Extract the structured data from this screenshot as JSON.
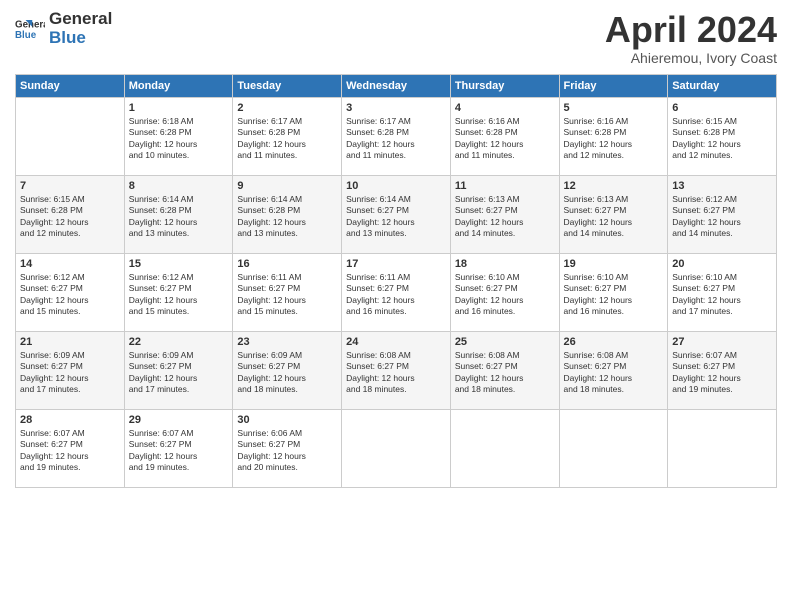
{
  "header": {
    "logo_line1": "General",
    "logo_line2": "Blue",
    "month": "April 2024",
    "location": "Ahieremou, Ivory Coast"
  },
  "weekdays": [
    "Sunday",
    "Monday",
    "Tuesday",
    "Wednesday",
    "Thursday",
    "Friday",
    "Saturday"
  ],
  "weeks": [
    [
      {
        "day": "",
        "info": ""
      },
      {
        "day": "1",
        "info": "Sunrise: 6:18 AM\nSunset: 6:28 PM\nDaylight: 12 hours\nand 10 minutes."
      },
      {
        "day": "2",
        "info": "Sunrise: 6:17 AM\nSunset: 6:28 PM\nDaylight: 12 hours\nand 11 minutes."
      },
      {
        "day": "3",
        "info": "Sunrise: 6:17 AM\nSunset: 6:28 PM\nDaylight: 12 hours\nand 11 minutes."
      },
      {
        "day": "4",
        "info": "Sunrise: 6:16 AM\nSunset: 6:28 PM\nDaylight: 12 hours\nand 11 minutes."
      },
      {
        "day": "5",
        "info": "Sunrise: 6:16 AM\nSunset: 6:28 PM\nDaylight: 12 hours\nand 12 minutes."
      },
      {
        "day": "6",
        "info": "Sunrise: 6:15 AM\nSunset: 6:28 PM\nDaylight: 12 hours\nand 12 minutes."
      }
    ],
    [
      {
        "day": "7",
        "info": "Sunrise: 6:15 AM\nSunset: 6:28 PM\nDaylight: 12 hours\nand 12 minutes."
      },
      {
        "day": "8",
        "info": "Sunrise: 6:14 AM\nSunset: 6:28 PM\nDaylight: 12 hours\nand 13 minutes."
      },
      {
        "day": "9",
        "info": "Sunrise: 6:14 AM\nSunset: 6:28 PM\nDaylight: 12 hours\nand 13 minutes."
      },
      {
        "day": "10",
        "info": "Sunrise: 6:14 AM\nSunset: 6:27 PM\nDaylight: 12 hours\nand 13 minutes."
      },
      {
        "day": "11",
        "info": "Sunrise: 6:13 AM\nSunset: 6:27 PM\nDaylight: 12 hours\nand 14 minutes."
      },
      {
        "day": "12",
        "info": "Sunrise: 6:13 AM\nSunset: 6:27 PM\nDaylight: 12 hours\nand 14 minutes."
      },
      {
        "day": "13",
        "info": "Sunrise: 6:12 AM\nSunset: 6:27 PM\nDaylight: 12 hours\nand 14 minutes."
      }
    ],
    [
      {
        "day": "14",
        "info": "Sunrise: 6:12 AM\nSunset: 6:27 PM\nDaylight: 12 hours\nand 15 minutes."
      },
      {
        "day": "15",
        "info": "Sunrise: 6:12 AM\nSunset: 6:27 PM\nDaylight: 12 hours\nand 15 minutes."
      },
      {
        "day": "16",
        "info": "Sunrise: 6:11 AM\nSunset: 6:27 PM\nDaylight: 12 hours\nand 15 minutes."
      },
      {
        "day": "17",
        "info": "Sunrise: 6:11 AM\nSunset: 6:27 PM\nDaylight: 12 hours\nand 16 minutes."
      },
      {
        "day": "18",
        "info": "Sunrise: 6:10 AM\nSunset: 6:27 PM\nDaylight: 12 hours\nand 16 minutes."
      },
      {
        "day": "19",
        "info": "Sunrise: 6:10 AM\nSunset: 6:27 PM\nDaylight: 12 hours\nand 16 minutes."
      },
      {
        "day": "20",
        "info": "Sunrise: 6:10 AM\nSunset: 6:27 PM\nDaylight: 12 hours\nand 17 minutes."
      }
    ],
    [
      {
        "day": "21",
        "info": "Sunrise: 6:09 AM\nSunset: 6:27 PM\nDaylight: 12 hours\nand 17 minutes."
      },
      {
        "day": "22",
        "info": "Sunrise: 6:09 AM\nSunset: 6:27 PM\nDaylight: 12 hours\nand 17 minutes."
      },
      {
        "day": "23",
        "info": "Sunrise: 6:09 AM\nSunset: 6:27 PM\nDaylight: 12 hours\nand 18 minutes."
      },
      {
        "day": "24",
        "info": "Sunrise: 6:08 AM\nSunset: 6:27 PM\nDaylight: 12 hours\nand 18 minutes."
      },
      {
        "day": "25",
        "info": "Sunrise: 6:08 AM\nSunset: 6:27 PM\nDaylight: 12 hours\nand 18 minutes."
      },
      {
        "day": "26",
        "info": "Sunrise: 6:08 AM\nSunset: 6:27 PM\nDaylight: 12 hours\nand 18 minutes."
      },
      {
        "day": "27",
        "info": "Sunrise: 6:07 AM\nSunset: 6:27 PM\nDaylight: 12 hours\nand 19 minutes."
      }
    ],
    [
      {
        "day": "28",
        "info": "Sunrise: 6:07 AM\nSunset: 6:27 PM\nDaylight: 12 hours\nand 19 minutes."
      },
      {
        "day": "29",
        "info": "Sunrise: 6:07 AM\nSunset: 6:27 PM\nDaylight: 12 hours\nand 19 minutes."
      },
      {
        "day": "30",
        "info": "Sunrise: 6:06 AM\nSunset: 6:27 PM\nDaylight: 12 hours\nand 20 minutes."
      },
      {
        "day": "",
        "info": ""
      },
      {
        "day": "",
        "info": ""
      },
      {
        "day": "",
        "info": ""
      },
      {
        "day": "",
        "info": ""
      }
    ]
  ]
}
